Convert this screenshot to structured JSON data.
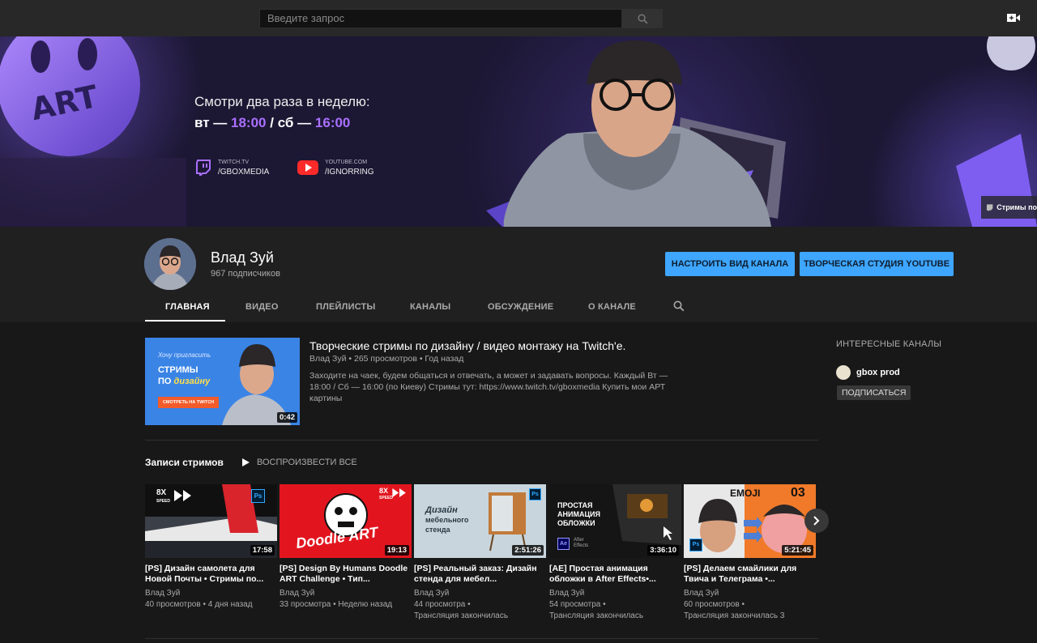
{
  "search": {
    "placeholder": "Введите запрос"
  },
  "banner": {
    "line1": "Смотри два раза в неделю:",
    "day1": "вт —",
    "time1": "18:00",
    "sep": "/",
    "day2": "сб —",
    "time2": "16:00",
    "logo_text": "ART",
    "twitch_small": "TWITCH.TV",
    "twitch_handle": "/GBOXMEDIA",
    "youtube_small": "YOUTUBE.COM",
    "youtube_handle": "/IGNORRING",
    "corner_link": "Стримы по"
  },
  "channel": {
    "name": "Влад Зуй",
    "subscribers": "967 подписчиков",
    "customize_label": "НАСТРОИТЬ ВИД КАНАЛА",
    "studio_label": "ТВОРЧЕСКАЯ СТУДИЯ YOUTUBE"
  },
  "tabs": [
    "ГЛАВНАЯ",
    "ВИДЕО",
    "ПЛЕЙЛИСТЫ",
    "КАНАЛЫ",
    "ОБСУЖДЕНИЕ",
    "О КАНАЛЕ"
  ],
  "featured": {
    "title": "Творческие стримы по дизайну / видео монтажу на Twitch'e.",
    "meta": "Влад Зуй • 265 просмотров • Год назад",
    "description": "Заходите на чаек, будем общаться и отвечать, а может и задавать вопросы. Каждый Вт — 18:00 / Сб — 16:00 (по Киеву) Стримы тут: https://www.twitch.tv/gboxmedia Купить мои АРТ картины",
    "duration": "0:42",
    "thumb_small": "Хочу пригласить",
    "thumb_big1": "СТРИМЫ",
    "thumb_big2a": "ПО ",
    "thumb_big2b": "дизайну",
    "thumb_button": "СМОТРЕТЬ НА TWITCH"
  },
  "shelf": {
    "title": "Записи стримов",
    "play_all": "ВОСПРОИЗВЕСТИ ВСЕ",
    "videos": [
      {
        "title": "[PS] Дизайн самолета для Новой Почты • Стримы по...",
        "channel": "Влад Зуй",
        "line2": "40 просмотров • 4 дня назад",
        "line3": "",
        "duration": "17:58",
        "thumb_speed": "8X",
        "thumb_speed_word": "SPEED",
        "thumb_badge": "Ps"
      },
      {
        "title": "[PS] Design By Humans Doodle ART Challenge • Тип...",
        "channel": "Влад Зуй",
        "line2": "33 просмотра • Неделю назад",
        "line3": "",
        "duration": "19:13",
        "thumb_speed": "8X",
        "thumb_speed_word": "SPEED",
        "thumb_text": "Doodle ART"
      },
      {
        "title": "[PS] Реальный заказ: Дизайн стенда для мебел...",
        "channel": "Влад Зуй",
        "line2": "44 просмотра •",
        "line3": "Трансляция закончилась",
        "duration": "2:51:26",
        "thumb_badge": "Ps",
        "thumb_text1": "Дизайн",
        "thumb_text2": "мебельного",
        "thumb_text3": "стенда"
      },
      {
        "title": "[AE] Простая анимация обложки в After Effects•...",
        "channel": "Влад Зуй",
        "line2": "54 просмотра •",
        "line3": "Трансляция закончилась",
        "duration": "3:36:10",
        "thumb_text1": "ПРОСТАЯ",
        "thumb_text2": "АНИМАЦИЯ",
        "thumb_text3": "ОБЛОЖКИ",
        "thumb_badge": "Ae",
        "thumb_small": "After Effects"
      },
      {
        "title": "[PS] Делаем смайлики для Твича и Телеграма •...",
        "channel": "Влад Зуй",
        "line2": "60 просмотров •",
        "line3": "Трансляция закончилась 3",
        "duration": "5:21:45",
        "thumb_text1": "EMOJI",
        "thumb_text2": "03",
        "thumb_badge": "Ps"
      }
    ]
  },
  "sidebar": {
    "title": "ИНТЕРЕСНЫЕ КАНАЛЫ",
    "channel_name": "gbox prod",
    "subscribe_label": "ПОДПИСАТЬСЯ"
  },
  "colors": {
    "accent_blue": "#3ea6ff",
    "twitch_purple": "#a970ff",
    "background": "#181818",
    "header": "#202020"
  }
}
